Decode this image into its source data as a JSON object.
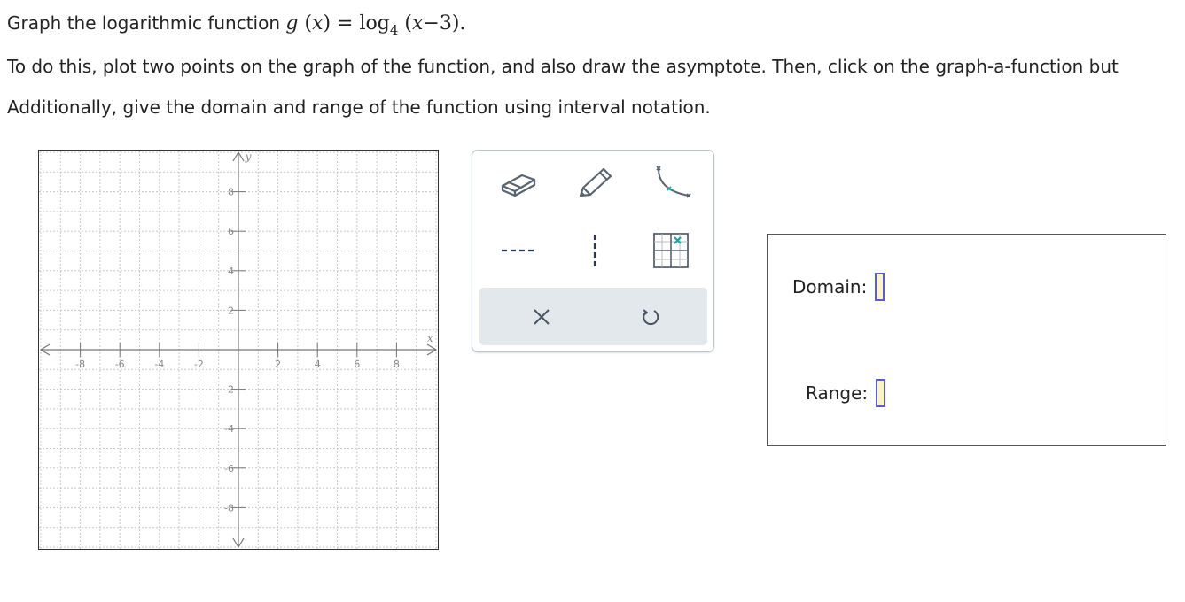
{
  "question": {
    "line1_prefix": "Graph the logarithmic function ",
    "function": {
      "name": "g",
      "open_paren": "(",
      "var": "x",
      "close_paren_eq": ") = ",
      "log": "log",
      "base": "4",
      "arg_open": " (",
      "arg_var": "x",
      "arg_rest": "−3).",
      "math_text": "g (x) = log4 (x−3)."
    },
    "line2": "To do this, plot two points on the graph of the function, and also draw the asymptote. Then, click on the graph-a-function but",
    "line3": "Additionally, give the domain and range of the function using interval notation."
  },
  "graph": {
    "x_axis_label": "x",
    "y_axis_label": "y",
    "x_min": -10,
    "x_max": 10,
    "y_min": -10,
    "y_max": 10,
    "grid_step": 1,
    "x_tick_labels": [
      "-8",
      "-6",
      "-4",
      "-2",
      "2",
      "4",
      "6",
      "8"
    ],
    "y_tick_labels": [
      "8",
      "6",
      "4",
      "2",
      "-2",
      "-4",
      "-6",
      "-8"
    ],
    "colors": {
      "axis": "#777777",
      "grid": "#c8c8c8",
      "label": "#888888"
    }
  },
  "toolbox": {
    "tools": [
      {
        "id": "eraser",
        "icon": "eraser-icon"
      },
      {
        "id": "pencil",
        "icon": "pencil-icon"
      },
      {
        "id": "curve",
        "icon": "curve-points-icon"
      },
      {
        "id": "dashed",
        "icon": "dashed-line-icon"
      },
      {
        "id": "vdashed",
        "icon": "vertical-dashed-line-icon"
      },
      {
        "id": "graphfn",
        "icon": "graph-function-icon"
      }
    ],
    "actions": {
      "clear_icon": "x-icon",
      "undo_icon": "undo-icon"
    },
    "colors": {
      "icon": "#5a6570",
      "accent": "#1fa3a3",
      "bar": "#e2e8ec"
    }
  },
  "answers": {
    "domain_label": "Domain:",
    "range_label": "Range:",
    "domain_value": "",
    "range_value": "",
    "colors": {
      "input_fill": "#fdf3c9",
      "input_border": "#5a5fc8"
    }
  }
}
